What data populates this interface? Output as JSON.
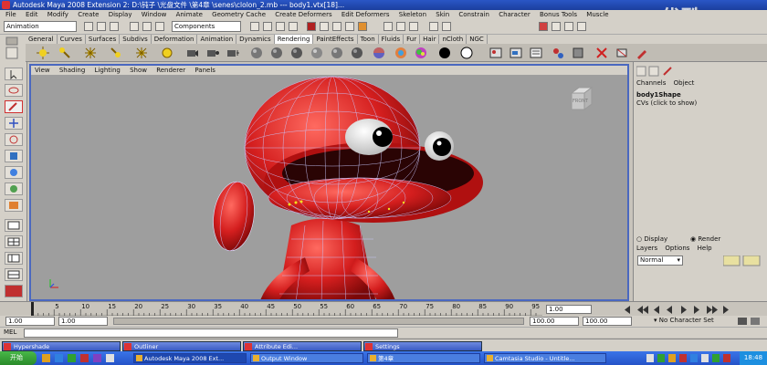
{
  "window": {
    "title": "Autodesk Maya 2008 Extension 2: D:\\钝子 \\光盘文件 \\第4章 \\senes\\clolon_2.mb  ---  body1.vtx[18]..."
  },
  "watermark": "优酷",
  "menubar": [
    "File",
    "Edit",
    "Modify",
    "Create",
    "Display",
    "Window",
    "Animate",
    "Geometry Cache",
    "Create Deformers",
    "Edit Deformers",
    "Skeleton",
    "Skin",
    "Constrain",
    "Character",
    "Bonus Tools",
    "Muscle"
  ],
  "toolbar": {
    "menuset": "Animation",
    "selection_mask": "Components"
  },
  "shelf_tabs": [
    "General",
    "Curves",
    "Surfaces",
    "Subdivs",
    "Deformation",
    "Animation",
    "Dynamics",
    "Rendering",
    "PaintEffects",
    "Toon",
    "Fluids",
    "Fur",
    "Hair",
    "nCloth",
    "NGC"
  ],
  "shelf_active": "Rendering",
  "viewport": {
    "menu": [
      "View",
      "Shading",
      "Lighting",
      "Show",
      "Renderer",
      "Panels"
    ],
    "viewcube_label": "FRONT"
  },
  "channel_box": {
    "tabs": [
      "Channels",
      "Object"
    ],
    "shape_name": "body1Shape",
    "cvs_label": "CVs (click to show)",
    "radio_display": "Display",
    "radio_render": "Render",
    "layer_menu": [
      "Layers",
      "Options",
      "Help"
    ],
    "layer_mode": "Normal"
  },
  "timeline": {
    "ticks": [
      "5",
      "10",
      "15",
      "20",
      "25",
      "30",
      "35",
      "40",
      "45",
      "50",
      "55",
      "60",
      "65",
      "70",
      "75",
      "80",
      "85",
      "90",
      "95"
    ],
    "current_frame": "1.00"
  },
  "range": {
    "start": "1.00",
    "inner_start": "1.00",
    "inner_end": "100.00",
    "end": "100.00",
    "character_set": "No Character Set"
  },
  "mel_label": "MEL",
  "minimized_windows": [
    "Hypershade",
    "Outliner",
    "Attribute Edi...",
    "Settings"
  ],
  "taskbar": {
    "start": "开始",
    "tasks": [
      "Autodesk Maya 2008 Ext...",
      "Output Window",
      "第4章",
      "Camtasia Studio - Untitle..."
    ],
    "clock": "18:48"
  }
}
